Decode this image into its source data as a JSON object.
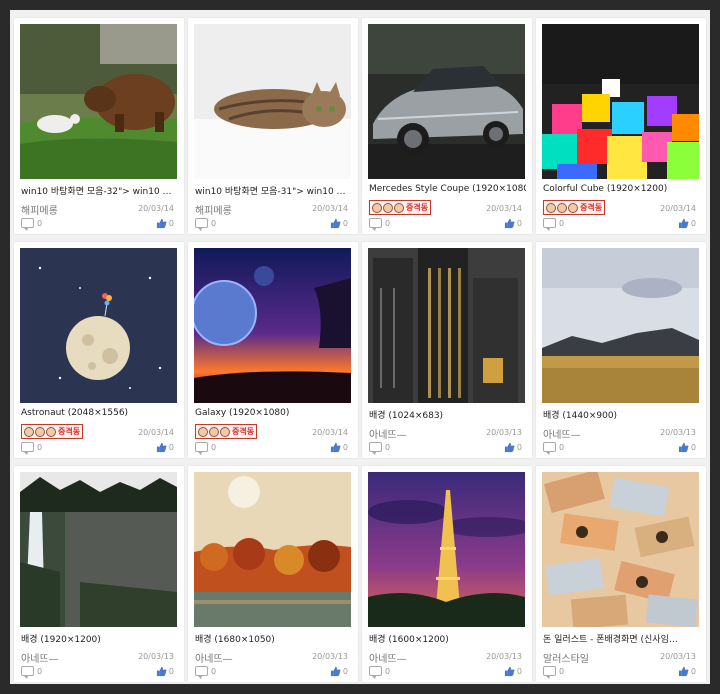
{
  "cards": [
    {
      "title": "win10 바탕화면 모음-32\"> win10 …",
      "author": "해피메롱",
      "author_badge": false,
      "date": "20/03/14",
      "comments": "0",
      "likes": "0",
      "image": "bear"
    },
    {
      "title": "win10 바탕화면 모음-31\"> win10 …",
      "author": "해피메롱",
      "author_badge": false,
      "date": "20/03/14",
      "comments": "0",
      "likes": "0",
      "image": "cat"
    },
    {
      "title": "Mercedes Style Coupe (1920×1080)",
      "author": "",
      "author_badge": true,
      "date": "20/03/14",
      "comments": "0",
      "likes": "0",
      "image": "car"
    },
    {
      "title": "Colorful Cube (1920×1200)",
      "author": "",
      "author_badge": true,
      "date": "20/03/14",
      "comments": "0",
      "likes": "0",
      "image": "cubes"
    },
    {
      "title": "Astronaut (2048×1556)",
      "author": "",
      "author_badge": true,
      "date": "20/03/14",
      "comments": "0",
      "likes": "0",
      "image": "moon"
    },
    {
      "title": "Galaxy (1920×1080)",
      "author": "",
      "author_badge": true,
      "date": "20/03/14",
      "comments": "0",
      "likes": "0",
      "image": "galaxy"
    },
    {
      "title": "배경 (1024×683)",
      "author": "아네뜨—",
      "author_badge": false,
      "date": "20/03/13",
      "comments": "0",
      "likes": "0",
      "image": "city"
    },
    {
      "title": "배경 (1440×900)",
      "author": "아네뜨—",
      "author_badge": false,
      "date": "20/03/13",
      "comments": "0",
      "likes": "0",
      "image": "desert"
    },
    {
      "title": "배경 (1920×1200)",
      "author": "아네뜨—",
      "author_badge": false,
      "date": "20/03/13",
      "comments": "0",
      "likes": "0",
      "image": "waterfall"
    },
    {
      "title": "배경 (1680×1050)",
      "author": "아네뜨—",
      "author_badge": false,
      "date": "20/03/13",
      "comments": "0",
      "likes": "0",
      "image": "autumn"
    },
    {
      "title": "배경 (1600×1200)",
      "author": "아네뜨—",
      "author_badge": false,
      "date": "20/03/13",
      "comments": "0",
      "likes": "0",
      "image": "eiffel"
    },
    {
      "title": "돈 일러스트 - 폰배경화면 (신사임…",
      "author": "알러스타일",
      "author_badge": false,
      "date": "20/03/13",
      "comments": "0",
      "likes": "0",
      "image": "money"
    }
  ],
  "badge": {
    "text": "중격동"
  }
}
